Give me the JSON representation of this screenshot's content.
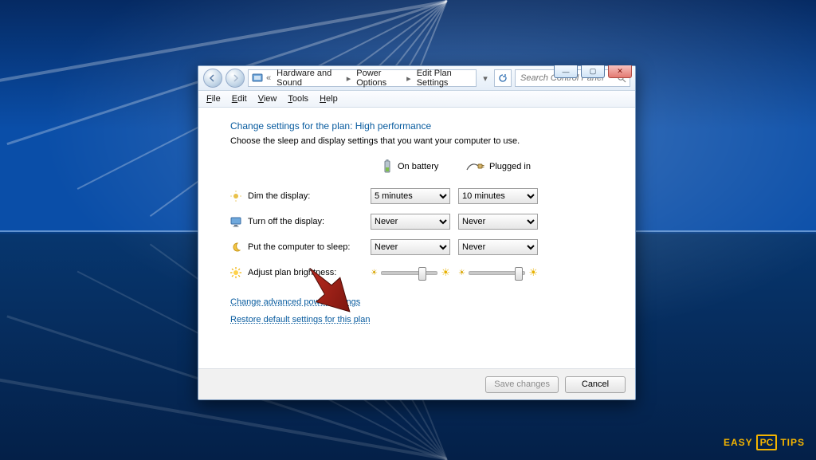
{
  "breadcrumb": {
    "seg1": "Hardware and Sound",
    "seg2": "Power Options",
    "seg3": "Edit Plan Settings"
  },
  "search": {
    "placeholder": "Search Control Panel"
  },
  "menu": {
    "file": "File",
    "edit": "Edit",
    "view": "View",
    "tools": "Tools",
    "help": "Help"
  },
  "heading": "Change settings for the plan: High performance",
  "sub": "Choose the sleep and display settings that you want your computer to use.",
  "columns": {
    "battery": "On battery",
    "plugged": "Plugged in"
  },
  "rows": {
    "dim": {
      "label": "Dim the display:",
      "battery": "5 minutes",
      "plugged": "10 minutes"
    },
    "off": {
      "label": "Turn off the display:",
      "battery": "Never",
      "plugged": "Never"
    },
    "sleep": {
      "label": "Put the computer to sleep:",
      "battery": "Never",
      "plugged": "Never"
    },
    "bright": {
      "label": "Adjust plan brightness:"
    }
  },
  "links": {
    "advanced": "Change advanced power settings",
    "restore": "Restore default settings for this plan"
  },
  "buttons": {
    "save": "Save changes",
    "cancel": "Cancel"
  },
  "caption": {
    "min": "minimize",
    "max": "maximize",
    "close": "close"
  },
  "logo": {
    "pre": "EASY",
    "mid": "PC",
    "post": "TIPS"
  }
}
